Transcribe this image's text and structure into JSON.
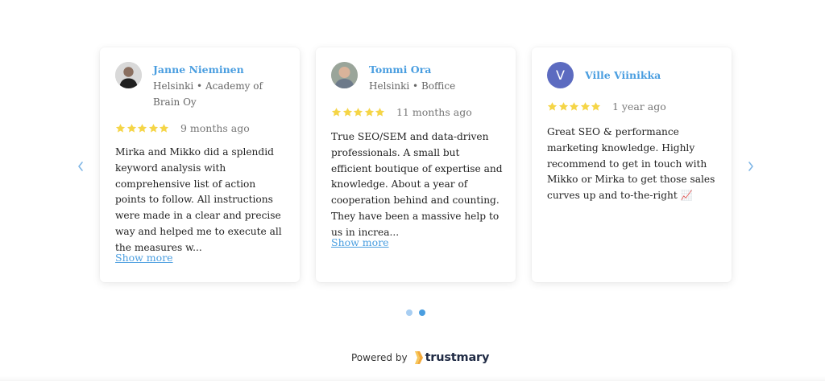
{
  "carousel": {
    "prev_icon": "chevron-left-icon",
    "next_icon": "chevron-right-icon",
    "reviews": [
      {
        "name": "Janne Nieminen",
        "location": "Helsinki • Academy of Brain Oy",
        "rating": 5,
        "time": "9 months ago",
        "text": "Mirka and Mikko did a splendid keyword analysis with comprehensive list of action points to follow. All instructions were made in a clear and precise way and helped me to execute all the measures w...",
        "show_more": "Show more"
      },
      {
        "name": "Tommi Ora",
        "location": "Helsinki • Boffice",
        "rating": 5,
        "time": "11 months ago",
        "text": "True SEO/SEM and data-driven professionals. A small but efficient boutique of expertise and knowledge. About a year of cooperation behind and counting. They have been a massive help to us in increa...",
        "show_more": "Show more"
      },
      {
        "name": "Ville Viinikka",
        "avatar_letter": "V",
        "rating": 5,
        "time": "1 year ago",
        "text": "Great SEO & performance marketing knowledge. Highly recommend to get in touch with Mikko or Mirka to get those sales curves up and to-the-right 📈"
      }
    ],
    "pagination": {
      "pages": 2,
      "current": 2
    }
  },
  "footer": {
    "powered_by": "Powered by",
    "brand": "trustmary"
  },
  "colors": {
    "accent": "#4a9ee0",
    "star": "#f5d547",
    "avatar_v": "#5c6bc0"
  }
}
